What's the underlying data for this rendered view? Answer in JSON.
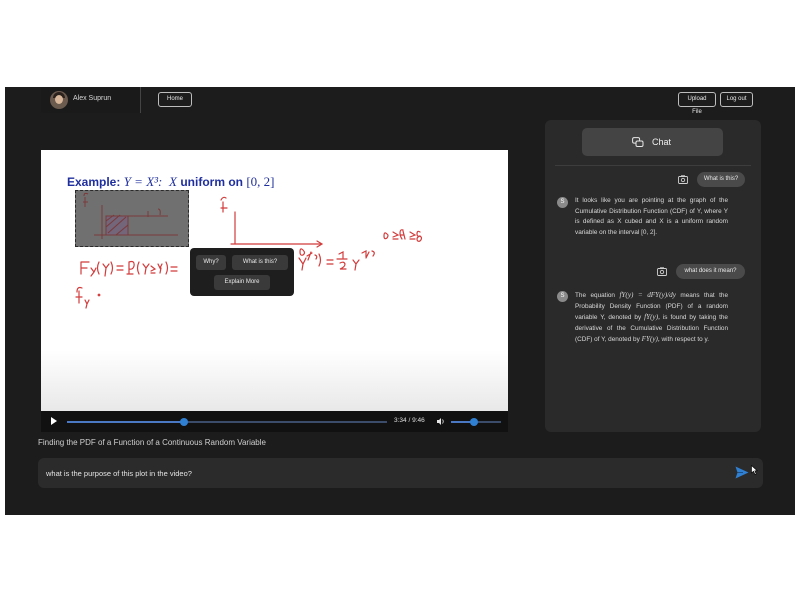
{
  "header": {
    "user_name": "Alex Suprun",
    "home_label": "Home",
    "upload_label": "Upload File",
    "logout_label": "Log out"
  },
  "slide": {
    "title_prefix": "Example:",
    "title_expr": "Y = X³:",
    "title_var": "X",
    "title_mid": "uniform on",
    "title_interval": "[0, 2]"
  },
  "popup": {
    "why_label": "Why?",
    "what_label": "What is this?",
    "explain_label": "Explain More"
  },
  "player": {
    "time": "3:34 / 9:46",
    "progress": 0.365,
    "volume": 0.45
  },
  "video_title": "Finding the PDF of a Function of a Continuous Random Variable",
  "chat": {
    "header_label": "Chat",
    "messages": [
      {
        "role": "user",
        "text": "What is this?"
      },
      {
        "role": "assistant",
        "avatar": "S",
        "text": "It looks like you are pointing at the graph of the Cumulative Distribution Function (CDF) of Y, where Y is defined as X cubed and X is a uniform random variable on the interval [0, 2]."
      },
      {
        "role": "user",
        "text": "what does it mean?"
      },
      {
        "role": "assistant",
        "avatar": "S",
        "text_1": "The equation",
        "math_1": "fY(y) = dFY(y)/dy",
        "text_2": "means that the Probability Density Function (PDF) of a random variable Y, denoted by",
        "math_2": "fY(y),",
        "text_3": "is found by taking the derivative of the Cumulative Distribution Function (CDF) of Y, denoted by",
        "math_3": "FY(y),",
        "text_4": "with respect to y."
      }
    ]
  },
  "input": {
    "value": "what is the purpose of this plot in the video?"
  },
  "colors": {
    "background": "#1c1c1c",
    "panel": "#2a2a2a",
    "accent": "#2f7fd3",
    "slide_title": "#1f2f9e",
    "handwriting": "#d23b3b"
  }
}
